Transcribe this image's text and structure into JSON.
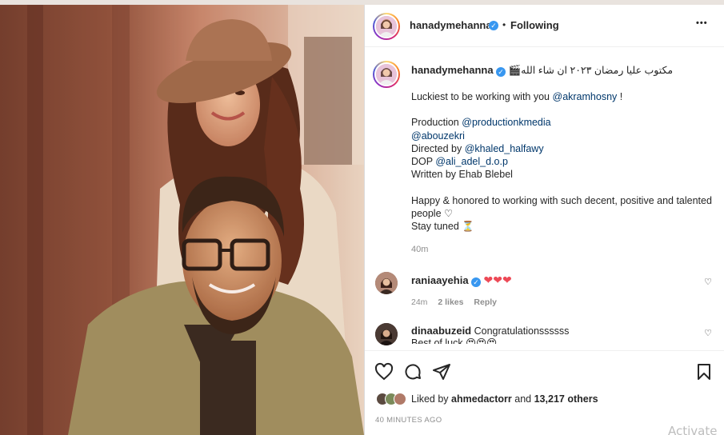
{
  "header": {
    "username": "hanadymehanna",
    "separator": "•",
    "follow_status": "Following",
    "more_label": "•••"
  },
  "caption": {
    "username": "hanadymehanna",
    "line1": "مكتوب عليا رمضان ٢٠٢٣ ان شاء الله🎬",
    "lucky_prefix": "Luckiest to be working with you",
    "lucky_mention": "@akramhosny",
    "lucky_suffix": " !",
    "production_label": "Production",
    "production_mention": "@productionkmedia",
    "abouzekri_mention": "@abouzekri",
    "directed_label": "Directed by",
    "directed_mention": "@khaled_halfawy",
    "dop_label": "DOP",
    "dop_mention": "@ali_adel_d.o.p",
    "written": "Written by Ehab Blebel",
    "happy": "Happy & honored to working with such decent, positive and talented people ♡",
    "stay": "Stay tuned ⏳",
    "time": "40m"
  },
  "comments": [
    {
      "username": "raniaayehia",
      "text": "❤❤❤",
      "time": "24m",
      "likes": "2 likes",
      "reply": "Reply"
    },
    {
      "username": "dinaabuzeid",
      "text": "Congratulationssssss",
      "text2": "Best of luck 😍😍😍"
    }
  ],
  "likes": {
    "prefix": "Liked by",
    "user": "ahmedactorr",
    "middle": "and",
    "count": "13,217 others"
  },
  "timestamp": "40 MINUTES AGO",
  "watermark": "Activate",
  "colors": {
    "link": "#00376b",
    "verified": "#3897f0",
    "heart": "#ed4956"
  }
}
